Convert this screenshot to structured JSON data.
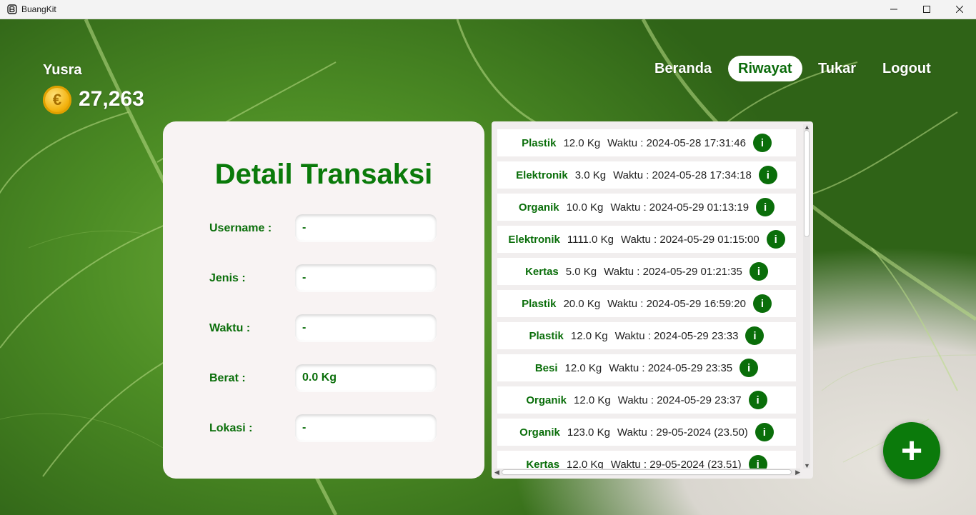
{
  "window": {
    "title": "BuangKit"
  },
  "user": {
    "name": "Yusra",
    "balance": "27,263",
    "coin_icon": "coin-euro-icon"
  },
  "nav": {
    "items": [
      {
        "label": "Beranda",
        "active": false
      },
      {
        "label": "Riwayat",
        "active": true
      },
      {
        "label": "Tukar",
        "active": false
      },
      {
        "label": "Logout",
        "active": false
      }
    ]
  },
  "detail": {
    "title": "Detail Transaksi",
    "fields": [
      {
        "label": "Username :",
        "value": "-"
      },
      {
        "label": "Jenis :",
        "value": "-"
      },
      {
        "label": "Waktu :",
        "value": "-"
      },
      {
        "label": "Berat :",
        "value": "0.0 Kg"
      },
      {
        "label": "Lokasi :",
        "value": "-"
      }
    ]
  },
  "history": {
    "info_label": "i",
    "rows": [
      {
        "jenis": "Plastik",
        "berat": "12.0 Kg",
        "waktu": "Waktu : 2024-05-28 17:31:46"
      },
      {
        "jenis": "Elektronik",
        "berat": "3.0 Kg",
        "waktu": "Waktu : 2024-05-28 17:34:18"
      },
      {
        "jenis": "Organik",
        "berat": "10.0 Kg",
        "waktu": "Waktu : 2024-05-29 01:13:19"
      },
      {
        "jenis": "Elektronik",
        "berat": "1111.0 Kg",
        "waktu": "Waktu : 2024-05-29 01:15:00"
      },
      {
        "jenis": "Kertas",
        "berat": "5.0 Kg",
        "waktu": "Waktu : 2024-05-29 01:21:35"
      },
      {
        "jenis": "Plastik",
        "berat": "20.0 Kg",
        "waktu": "Waktu : 2024-05-29 16:59:20"
      },
      {
        "jenis": "Plastik",
        "berat": "12.0 Kg",
        "waktu": "Waktu : 2024-05-29 23:33"
      },
      {
        "jenis": "Besi",
        "berat": "12.0 Kg",
        "waktu": "Waktu : 2024-05-29 23:35"
      },
      {
        "jenis": "Organik",
        "berat": "12.0 Kg",
        "waktu": "Waktu : 2024-05-29 23:37"
      },
      {
        "jenis": "Organik",
        "berat": "123.0 Kg",
        "waktu": "Waktu : 29-05-2024 (23.50)"
      },
      {
        "jenis": "Kertas",
        "berat": "12.0 Kg",
        "waktu": "Waktu : 29-05-2024 (23.51)"
      }
    ]
  },
  "fab": {
    "label": "+"
  },
  "colors": {
    "accent": "#0a6e0a",
    "title_green": "#0a7a0a",
    "card_bg": "#f8f3f3"
  }
}
